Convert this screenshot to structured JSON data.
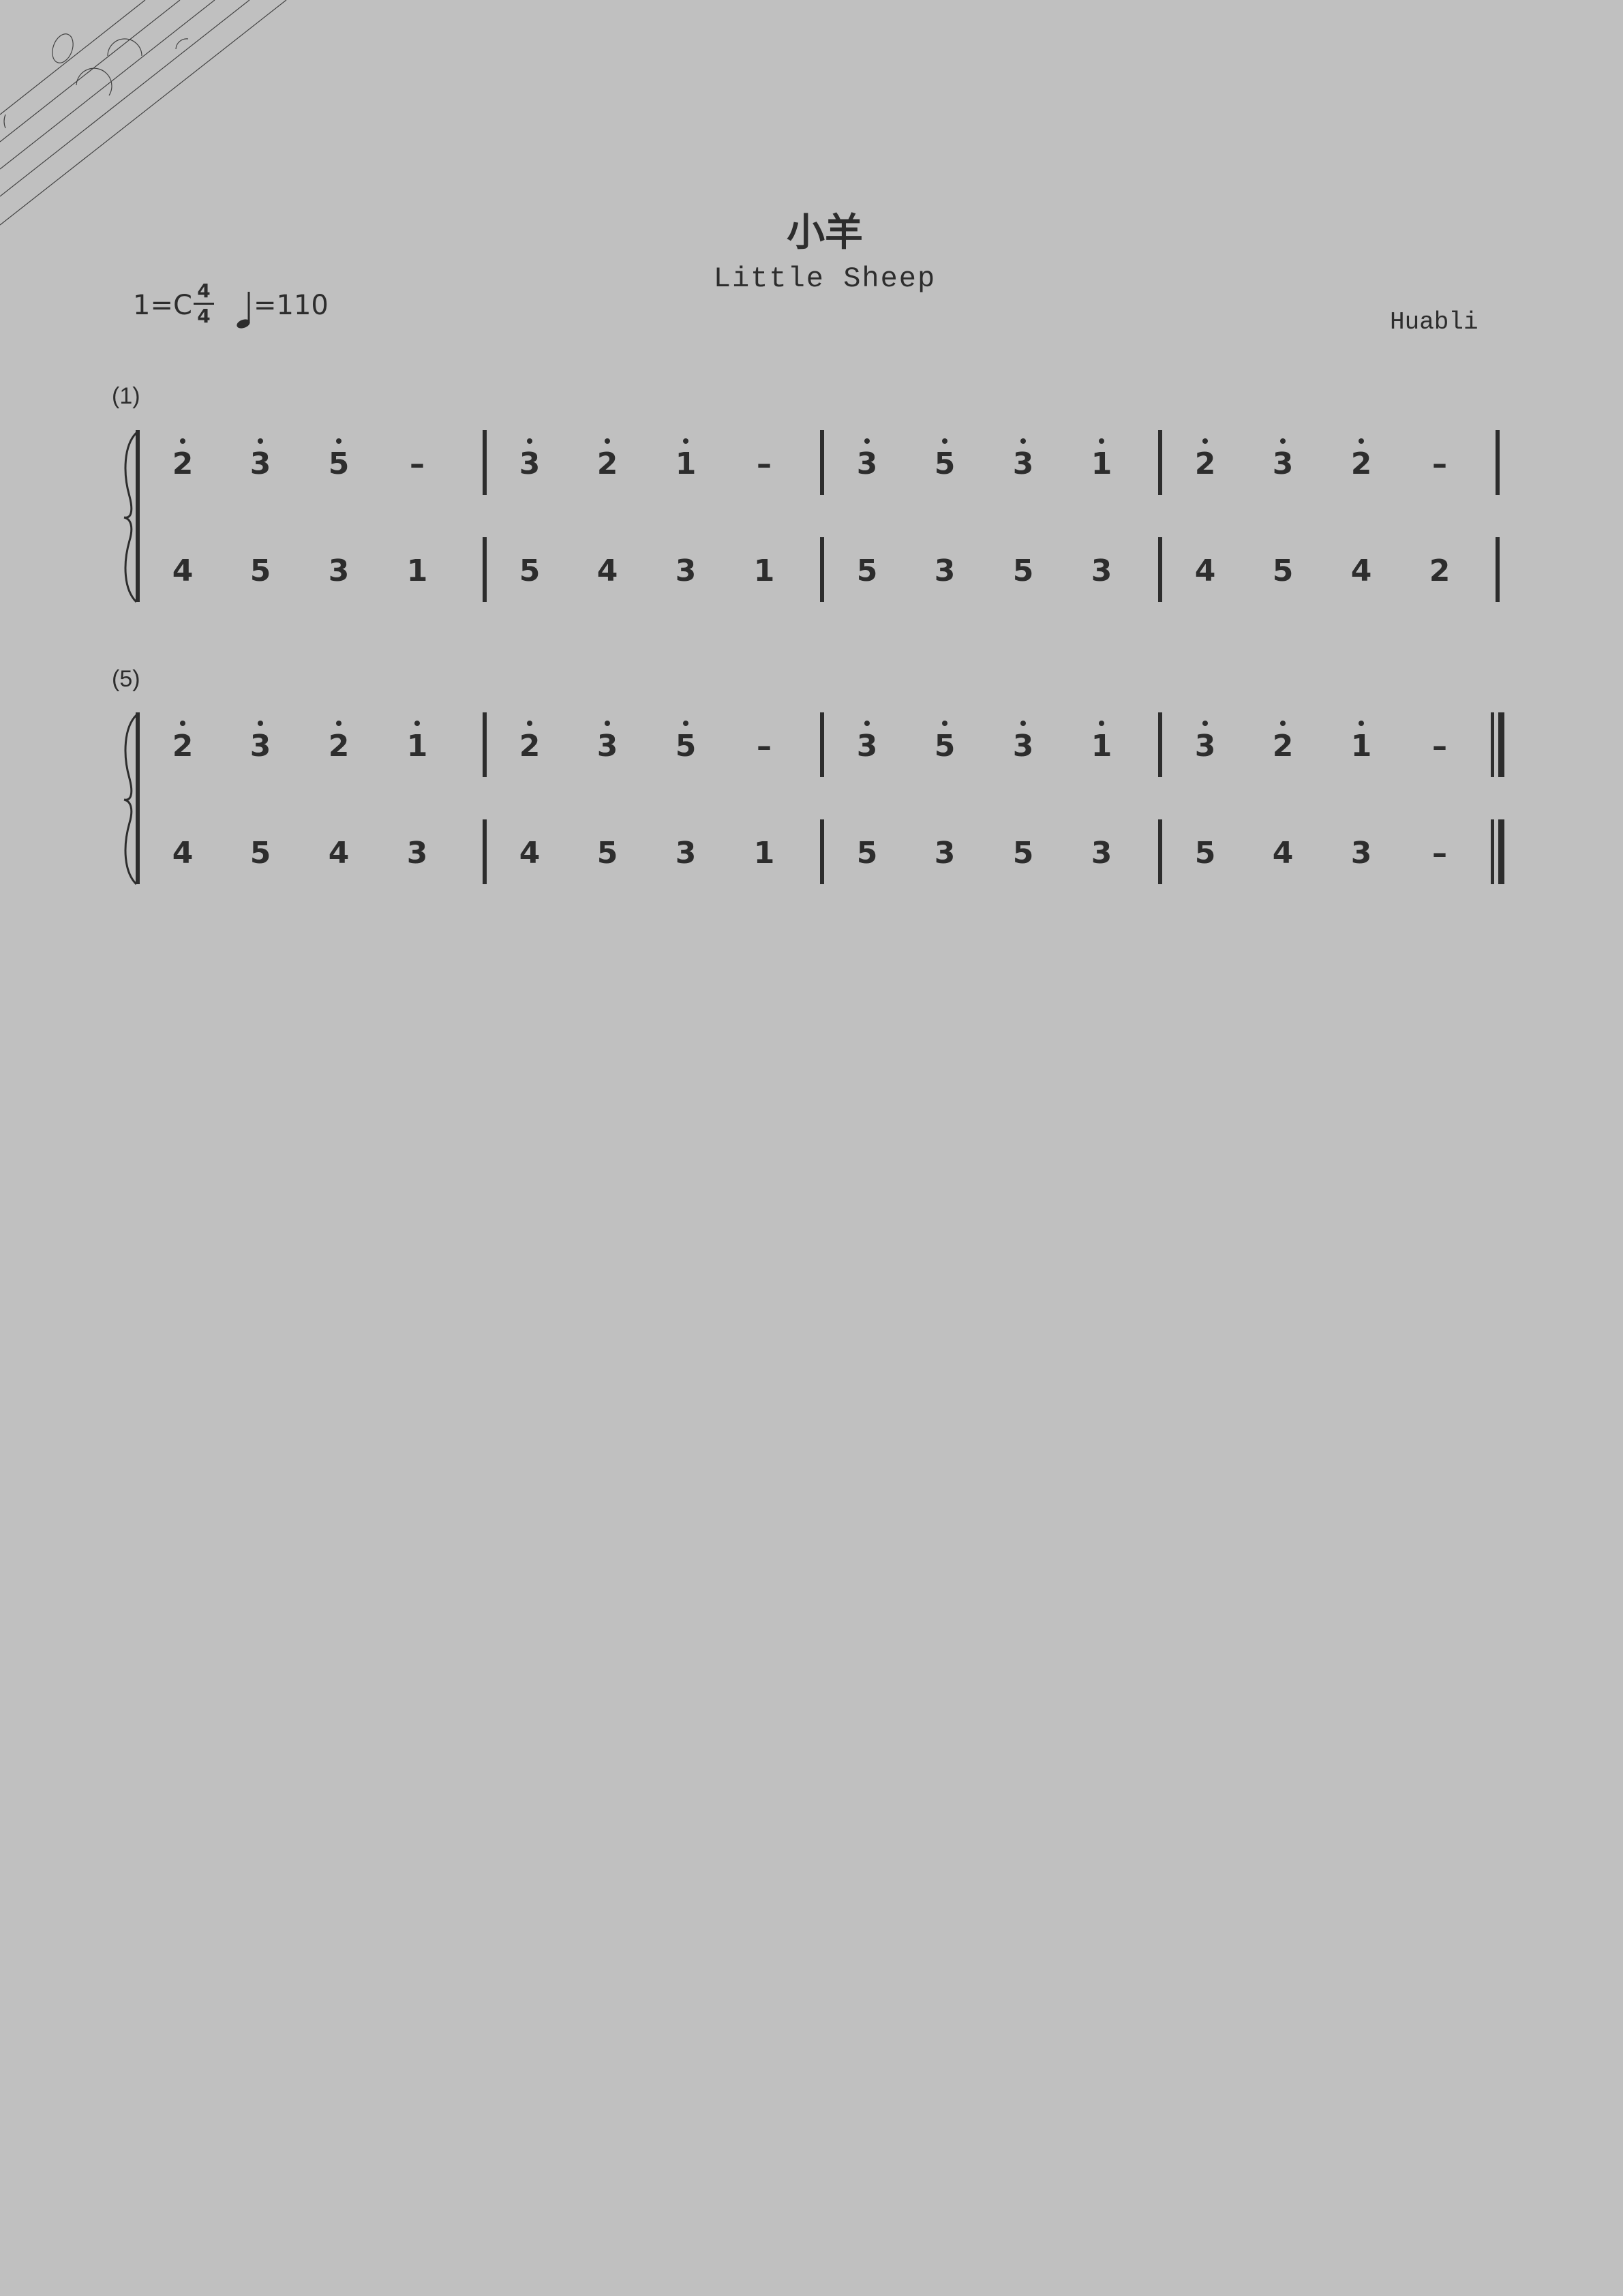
{
  "header": {
    "title": "小羊",
    "subtitle": "Little Sheep",
    "composer": "Huabli",
    "key": "1=C",
    "time_signature": {
      "numerator": "4",
      "denominator": "4"
    },
    "tempo": "=110",
    "tempo_note": "quarter-note-icon"
  },
  "colors": {
    "background": "#c0c0c0",
    "ink": "#2d2d2d"
  },
  "systems": [
    {
      "measure_number": "(1)",
      "measures": [
        {
          "upper": [
            {
              "n": "2",
              "dot": true
            },
            {
              "n": "3",
              "dot": true
            },
            {
              "n": "5",
              "dot": true
            },
            {
              "n": "–",
              "dot": false
            }
          ],
          "lower": [
            {
              "n": "4"
            },
            {
              "n": "5"
            },
            {
              "n": "3"
            },
            {
              "n": "1"
            }
          ]
        },
        {
          "upper": [
            {
              "n": "3",
              "dot": true
            },
            {
              "n": "2",
              "dot": true
            },
            {
              "n": "1",
              "dot": true
            },
            {
              "n": "–",
              "dot": false
            }
          ],
          "lower": [
            {
              "n": "5"
            },
            {
              "n": "4"
            },
            {
              "n": "3"
            },
            {
              "n": "1"
            }
          ]
        },
        {
          "upper": [
            {
              "n": "3",
              "dot": true
            },
            {
              "n": "5",
              "dot": true
            },
            {
              "n": "3",
              "dot": true
            },
            {
              "n": "1",
              "dot": true
            }
          ],
          "lower": [
            {
              "n": "5"
            },
            {
              "n": "3"
            },
            {
              "n": "5"
            },
            {
              "n": "3"
            }
          ]
        },
        {
          "upper": [
            {
              "n": "2",
              "dot": true
            },
            {
              "n": "3",
              "dot": true
            },
            {
              "n": "2",
              "dot": true
            },
            {
              "n": "–",
              "dot": false
            }
          ],
          "lower": [
            {
              "n": "4"
            },
            {
              "n": "5"
            },
            {
              "n": "4"
            },
            {
              "n": "2"
            }
          ]
        }
      ],
      "final": false
    },
    {
      "measure_number": "(5)",
      "measures": [
        {
          "upper": [
            {
              "n": "2",
              "dot": true
            },
            {
              "n": "3",
              "dot": true
            },
            {
              "n": "2",
              "dot": true
            },
            {
              "n": "1",
              "dot": true
            }
          ],
          "lower": [
            {
              "n": "4"
            },
            {
              "n": "5"
            },
            {
              "n": "4"
            },
            {
              "n": "3"
            }
          ]
        },
        {
          "upper": [
            {
              "n": "2",
              "dot": true
            },
            {
              "n": "3",
              "dot": true
            },
            {
              "n": "5",
              "dot": true
            },
            {
              "n": "–",
              "dot": false
            }
          ],
          "lower": [
            {
              "n": "4"
            },
            {
              "n": "5"
            },
            {
              "n": "3"
            },
            {
              "n": "1"
            }
          ]
        },
        {
          "upper": [
            {
              "n": "3",
              "dot": true
            },
            {
              "n": "5",
              "dot": true
            },
            {
              "n": "3",
              "dot": true
            },
            {
              "n": "1",
              "dot": true
            }
          ],
          "lower": [
            {
              "n": "5"
            },
            {
              "n": "3"
            },
            {
              "n": "5"
            },
            {
              "n": "3"
            }
          ]
        },
        {
          "upper": [
            {
              "n": "3",
              "dot": true
            },
            {
              "n": "2",
              "dot": true
            },
            {
              "n": "1",
              "dot": true
            },
            {
              "n": "–",
              "dot": false
            }
          ],
          "lower": [
            {
              "n": "5"
            },
            {
              "n": "4"
            },
            {
              "n": "3"
            },
            {
              "n": "–"
            }
          ]
        }
      ],
      "final": true
    }
  ]
}
